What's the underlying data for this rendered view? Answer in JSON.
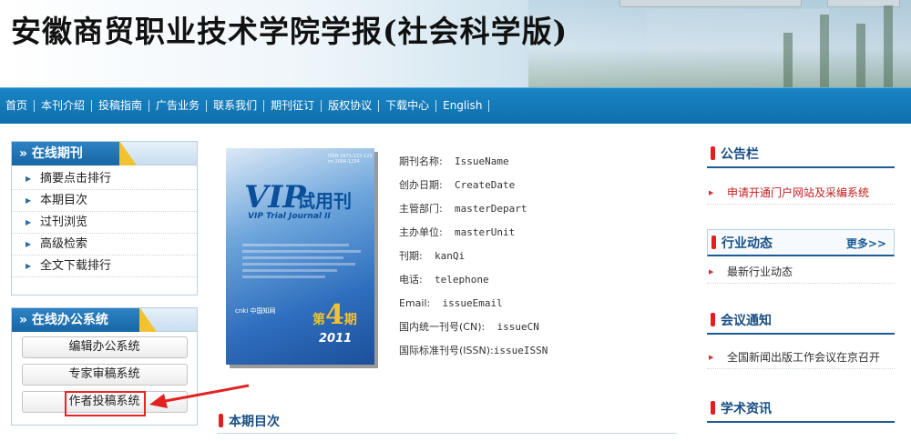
{
  "site": {
    "title": "安徽商贸职业技术学院学报(社会科学版)"
  },
  "nav": {
    "items": [
      "首页",
      "本刊介绍",
      "投稿指南",
      "广告业务",
      "联系我们",
      "期刊征订",
      "版权协议",
      "下载中心",
      "English"
    ]
  },
  "left": {
    "online_journal": {
      "title": "在线期刊",
      "items": [
        "摘要点击排行",
        "本期目次",
        "过刊浏览",
        "高级检索",
        "全文下载排行"
      ]
    },
    "online_office": {
      "title": "在线办公系统",
      "buttons": [
        "编辑办公系统",
        "专家审稿系统",
        "作者投稿系统"
      ]
    }
  },
  "cover": {
    "issn_text": "ISSN 1671-123-123 cn 2004-1234",
    "vip": "VIP",
    "trial": "试用刊",
    "subtitle": "VIP Trial Journal II",
    "cnki": "cnki 中国知网",
    "issue_prefix": "第",
    "issue_num": "4",
    "issue_suffix": "期",
    "year": "2011"
  },
  "info": [
    {
      "label": "期刊名称:",
      "value": "IssueName"
    },
    {
      "label": "创办日期:",
      "value": "CreateDate"
    },
    {
      "label": "主管部门:",
      "value": "masterDepart"
    },
    {
      "label": "主办单位:",
      "value": "masterUnit"
    },
    {
      "label": "刊期:",
      "value": "kanQi"
    },
    {
      "label": "电话:",
      "value": "telephone"
    },
    {
      "label": "Email:",
      "value": "issueEmail"
    },
    {
      "label": "国内统一刊号(CN):",
      "value": "issueCN"
    },
    {
      "label": "国际标准刊号(ISSN):",
      "value": "issueISSN"
    }
  ],
  "current_issue": {
    "title": "本期目次"
  },
  "right": {
    "notice": {
      "title": "公告栏",
      "items": [
        "申请开通门户网站及采编系统"
      ]
    },
    "industry": {
      "title": "行业动态",
      "more": "更多>>",
      "items": [
        "最新行业动态"
      ]
    },
    "meeting": {
      "title": "会议通知",
      "items": [
        "全国新闻出版工作会议在京召开"
      ]
    },
    "academic": {
      "title": "学术资讯"
    }
  },
  "colors": {
    "nav": "#1279b9",
    "accent_red": "#e02020",
    "link_red": "#c31c1c",
    "highlight": "#e22222"
  }
}
